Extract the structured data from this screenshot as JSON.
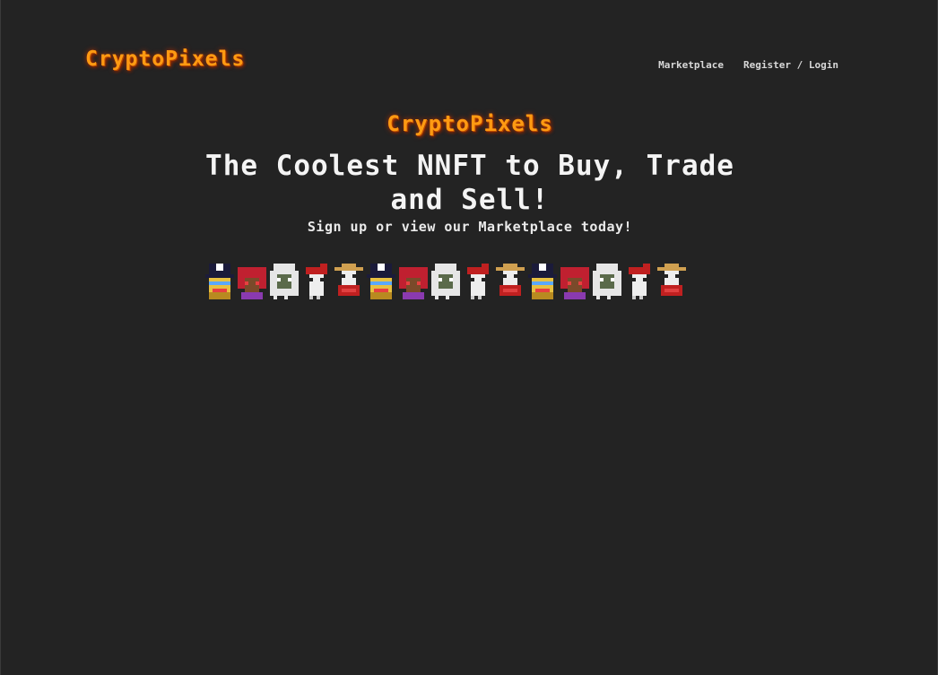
{
  "header": {
    "logo": "CryptoPixels",
    "nav": {
      "marketplace": "Marketplace",
      "register_login": "Register / Login"
    }
  },
  "hero": {
    "logo": "CryptoPixels",
    "title": "The Coolest NNFT to Buy, Trade and Sell!",
    "subtitle": "Sign up or view our Marketplace today!"
  },
  "pixels": [
    {
      "name": "pirate"
    },
    {
      "name": "jester"
    },
    {
      "name": "ghost"
    },
    {
      "name": "red-cap"
    },
    {
      "name": "straw-hat"
    },
    {
      "name": "pirate"
    },
    {
      "name": "jester"
    },
    {
      "name": "ghost"
    },
    {
      "name": "red-cap"
    },
    {
      "name": "straw-hat"
    },
    {
      "name": "pirate"
    },
    {
      "name": "jester"
    },
    {
      "name": "ghost"
    },
    {
      "name": "red-cap"
    },
    {
      "name": "straw-hat"
    }
  ]
}
